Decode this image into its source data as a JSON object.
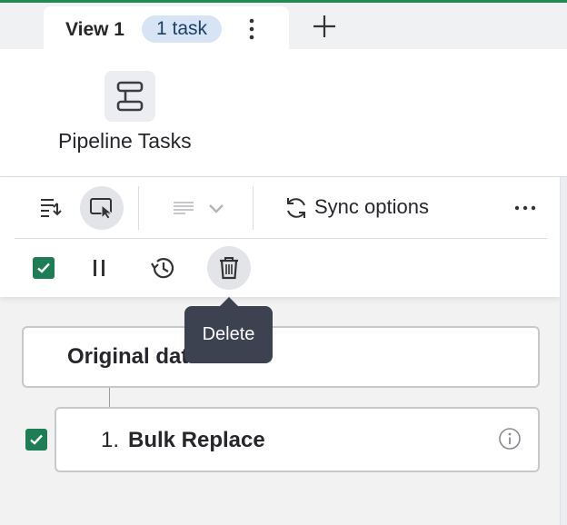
{
  "tabs": {
    "active_title": "View 1",
    "active_badge": "1 task"
  },
  "header": {
    "title": "Pipeline Tasks",
    "icon": "pipeline-icon"
  },
  "toolbar": {
    "sync_label": "Sync options",
    "icons": [
      "task-list-sync-icon",
      "select-cursor-icon",
      "text-align-icon",
      "chevron-down-icon",
      "sync-icon",
      "more-horizontal-icon"
    ]
  },
  "actions": {
    "icons": [
      "checkbox-checked-icon",
      "pause-icon",
      "history-icon",
      "trash-icon"
    ],
    "tooltip": "Delete"
  },
  "pipeline": {
    "dataset_title": "Original dataset",
    "steps": [
      {
        "number": "1.",
        "name": "Bulk Replace",
        "checked": true
      }
    ]
  },
  "colors": {
    "accent_green": "#1e7d55",
    "badge_bg": "#d6e4f6",
    "tooltip_bg": "#3c4250"
  }
}
